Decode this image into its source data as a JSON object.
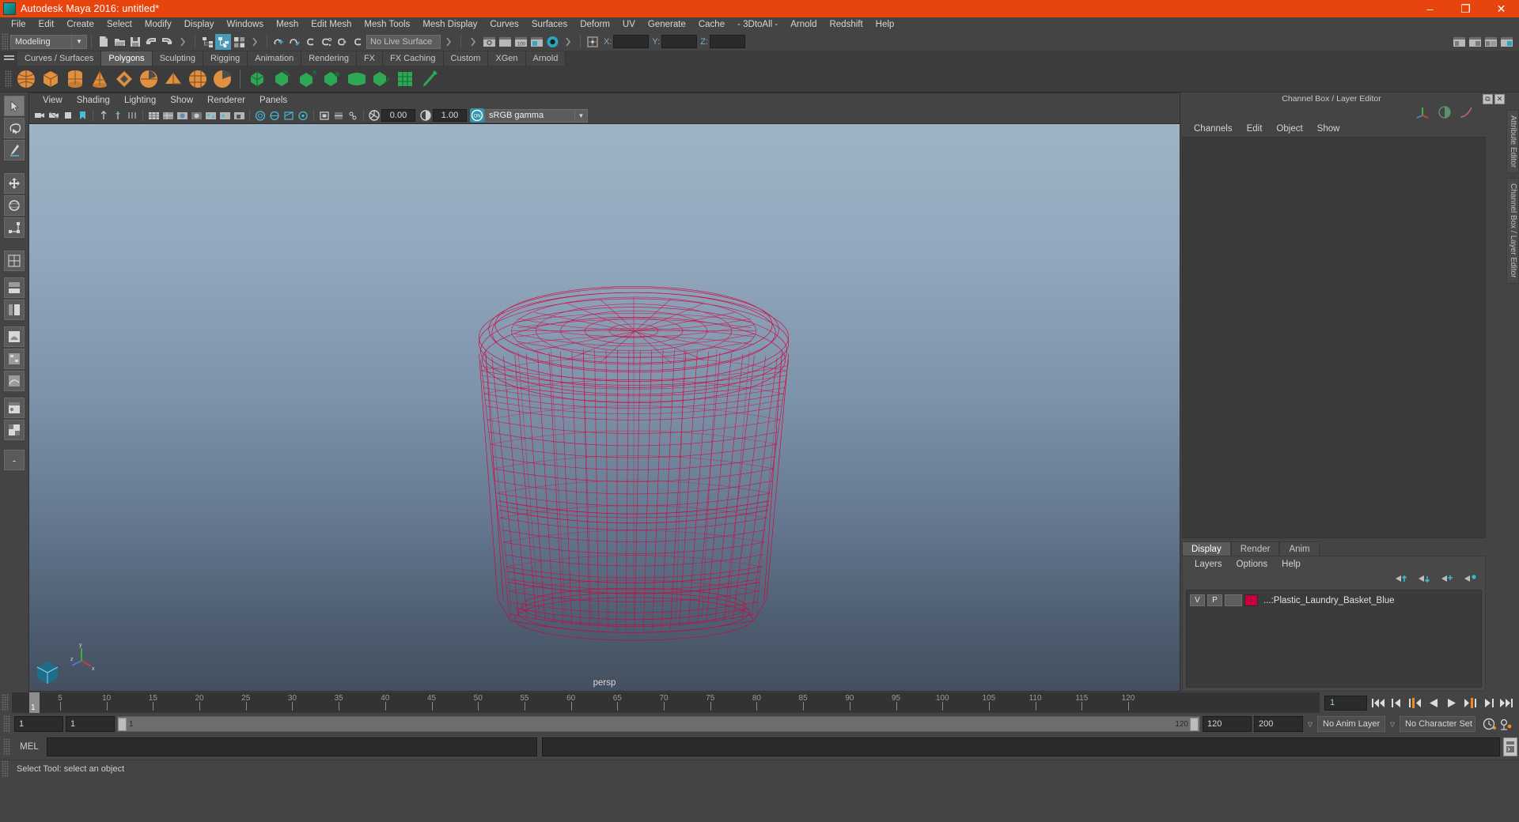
{
  "window": {
    "title": "Autodesk Maya 2016: untitled*",
    "minimize": "–",
    "maximize": "❐",
    "close": "✕",
    "titlebar_color": "#e8450e"
  },
  "menubar": {
    "items": [
      "File",
      "Edit",
      "Create",
      "Select",
      "Modify",
      "Display",
      "Windows",
      "Mesh",
      "Edit Mesh",
      "Mesh Tools",
      "Mesh Display",
      "Curves",
      "Surfaces",
      "Deform",
      "UV",
      "Generate",
      "Cache",
      "- 3DtoAll -",
      "Arnold",
      "Redshift",
      "Help"
    ]
  },
  "statusbar": {
    "select_mode": "Modeling",
    "select_mode_arrow": "▼",
    "live_surface": "No Live Surface",
    "coord_labels": {
      "x": "X:",
      "y": "Y:",
      "z": "Z:"
    },
    "coord_values": {
      "x": "",
      "y": "",
      "z": ""
    }
  },
  "shelf": {
    "tabs": [
      "Curves / Surfaces",
      "Polygons",
      "Sculpting",
      "Rigging",
      "Animation",
      "Rendering",
      "FX",
      "FX Caching",
      "Custom",
      "XGen",
      "Arnold"
    ],
    "active_tab": "Polygons",
    "icon_count_orange": 9,
    "icon_count_green": 7
  },
  "viewport": {
    "menu": [
      "View",
      "Shading",
      "Lighting",
      "Show",
      "Renderer",
      "Panels"
    ],
    "exposure": "0.00",
    "gamma": "1.00",
    "color_profile": "sRGB gamma",
    "color_profile_arrow": "▼",
    "camera_label": "persp",
    "axis_labels": {
      "x": "x",
      "y": "y",
      "z": "z"
    },
    "wireframe_color": "#d4003c",
    "bg_top": "#9fb3c6",
    "bg_bottom": "#44505f",
    "model": "Plastic Laundry Basket wireframe"
  },
  "right_panel": {
    "title": "Channel Box / Layer Editor",
    "undock_icon": "⧉",
    "close_icon": "✕",
    "channel_menu": [
      "Channels",
      "Edit",
      "Object",
      "Show"
    ],
    "layer_tabs": [
      "Display",
      "Render",
      "Anim"
    ],
    "layer_active_tab": "Display",
    "layer_menu": [
      "Layers",
      "Options",
      "Help"
    ],
    "layers": [
      {
        "visibility": "V",
        "playback": "P",
        "blank": "",
        "color": "#c6003c",
        "name": "...:Plastic_Laundry_Basket_Blue"
      }
    ],
    "vertical_tabs": [
      "Attribute Editor",
      "Channel Box / Layer Editor"
    ]
  },
  "timeline": {
    "ticks": [
      5,
      10,
      15,
      20,
      25,
      30,
      35,
      40,
      45,
      50,
      55,
      60,
      65,
      70,
      75,
      80,
      85,
      90,
      95,
      100,
      105,
      110,
      115,
      120
    ],
    "start": 1,
    "end": 120,
    "current_frame": "1",
    "cursor_label": "1",
    "transport": [
      "go-to-start",
      "step-back-key",
      "step-back-frame",
      "play-backwards",
      "play-forwards",
      "step-forward-frame",
      "step-forward-key",
      "go-to-end"
    ]
  },
  "range": {
    "anim_start": "1",
    "range_start": "1",
    "track_left_label": "1",
    "track_right_label": "120",
    "range_end": "120",
    "anim_end": "200",
    "anim_layer": "No Anim Layer",
    "character_set": "No Character Set",
    "dropdown_arrow": "▽"
  },
  "command_line": {
    "label": "MEL",
    "input_value": "",
    "output_value": "",
    "script_editor_icon": "script-editor"
  },
  "help_line": {
    "text": "Select Tool: select an object"
  },
  "toolbox": {
    "tools": [
      "select-tool",
      "lasso-select-tool",
      "paint-select-tool",
      "move-tool",
      "rotate-tool",
      "scale-tool",
      "last-tool",
      "layout-quad",
      "layout-two-panes-stacked",
      "layout-two-panes-side",
      "layout-single-persp",
      "layout-outliner",
      "layout-hypergraph",
      "layout-persp-graph",
      "layout-hypershade",
      "layout-custom",
      "layout-more"
    ]
  }
}
